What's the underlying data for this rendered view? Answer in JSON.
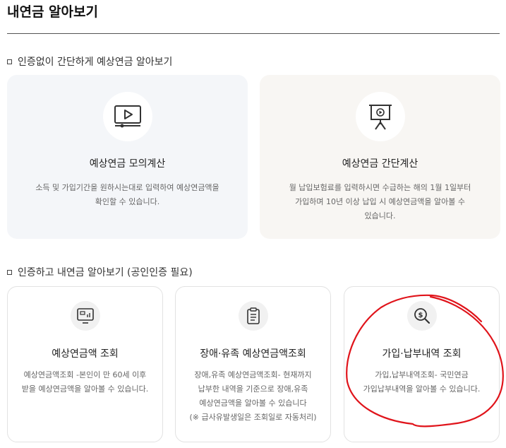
{
  "page": {
    "title": "내연금 알아보기"
  },
  "section1": {
    "heading": "인증없이 간단하게 예상연금 알아보기",
    "cards": [
      {
        "icon": "video-play-icon",
        "title": "예상연금 모의계산",
        "desc_lines": [
          "소득 및 가입기간을 원하시는대로 입력하여 예상연금액을",
          "확인할 수 있습니다."
        ]
      },
      {
        "icon": "presentation-board-icon",
        "title": "예상연금 간단계산",
        "desc_lines": [
          "월 납입보험료를 입력하시면 수급하는 해의 1월 1일부터",
          "가입하며 10년 이상 납입 시 예상연금액을 알아볼 수",
          "있습니다."
        ]
      }
    ]
  },
  "section2": {
    "heading": "인증하고 내연금 알아보기 (공인인증 필요)",
    "cards": [
      {
        "icon": "monitor-chart-icon",
        "title": "예상연금액 조회",
        "desc_lines": [
          "예상연금액조회 -본인이 만 60세 이후",
          "받을 예상연금액을 알아볼 수 있습니다."
        ]
      },
      {
        "icon": "clipboard-list-icon",
        "title": "장애·유족 예상연금액조회",
        "desc_lines": [
          "장애,유족 예상연금액조회- 현재까지",
          "납부한 내역을 기준으로 장애,유족",
          "예상연금액을 알아볼 수 있습니다",
          "(※ 급사유발생일은 조회일로 자동처리)"
        ]
      },
      {
        "icon": "dollar-search-icon",
        "title": "가입·납부내역 조회",
        "desc_lines": [
          "가입,납부내역조회- 국민연금",
          "가입납부내역을 알아볼 수 있습니다."
        ]
      }
    ]
  },
  "annotation": {
    "color": "#e0141b"
  }
}
